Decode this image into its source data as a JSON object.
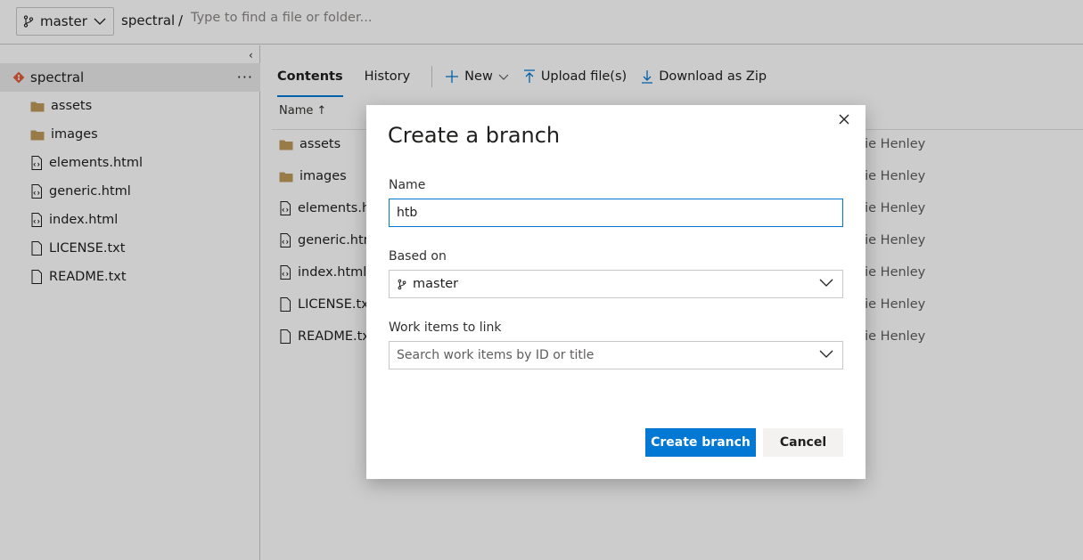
{
  "topbar": {
    "branch": "master",
    "repo": "spectral",
    "separator": "/",
    "path_placeholder": "Type to find a file or folder..."
  },
  "sidebar": {
    "collapse_glyph": "‹",
    "root": {
      "label": "spectral",
      "more": "···"
    },
    "items": [
      {
        "label": "assets",
        "icon": "folder-icon"
      },
      {
        "label": "images",
        "icon": "folder-icon"
      },
      {
        "label": "elements.html",
        "icon": "code-file-icon"
      },
      {
        "label": "generic.html",
        "icon": "code-file-icon"
      },
      {
        "label": "index.html",
        "icon": "code-file-icon"
      },
      {
        "label": "LICENSE.txt",
        "icon": "text-file-icon"
      },
      {
        "label": "README.txt",
        "icon": "text-file-icon"
      }
    ]
  },
  "main": {
    "tabs": [
      {
        "label": "Contents",
        "active": true
      },
      {
        "label": "History",
        "active": false
      }
    ],
    "commands": {
      "new": "New",
      "upload": "Upload file(s)",
      "download": "Download as Zip"
    },
    "column_name": "Name",
    "sort_glyph": "↑",
    "files": [
      {
        "label": "assets",
        "author": "halie Henley"
      },
      {
        "label": "images",
        "author": "halie Henley"
      },
      {
        "label": "elements.h",
        "author": "halie Henley"
      },
      {
        "label": "generic.htm",
        "author": "halie Henley"
      },
      {
        "label": "index.html",
        "author": "halie Henley"
      },
      {
        "label": "LICENSE.txt",
        "author": "halie Henley"
      },
      {
        "label": "README.txt",
        "author": "halie Henley"
      }
    ]
  },
  "dialog": {
    "title": "Create a branch",
    "name_label": "Name",
    "name_value": "htb",
    "based_on_label": "Based on",
    "based_on_value": "master",
    "work_items_label": "Work items to link",
    "work_items_placeholder": "Search work items by ID or title",
    "create_label": "Create branch",
    "cancel_label": "Cancel"
  },
  "colors": {
    "accent": "#0078d4",
    "folder": "#c09a5b",
    "git": "#e05d3b"
  }
}
